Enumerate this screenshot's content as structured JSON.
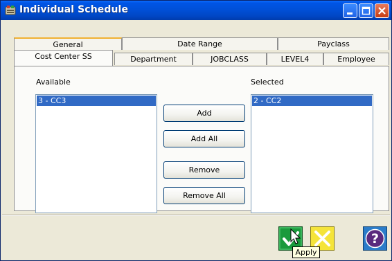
{
  "window": {
    "title": "Individual Schedule"
  },
  "tabs": {
    "row1": [
      "General",
      "Date Range",
      "Payclass"
    ],
    "row2": [
      "Cost Center SS",
      "Department",
      "JOBCLASS",
      "LEVEL4",
      "Employee"
    ],
    "active": "Cost Center SS"
  },
  "available": {
    "label": "Available",
    "items": [
      "3 - CC3"
    ],
    "selected_item": "3 - CC3"
  },
  "selected": {
    "label": "Selected",
    "items": [
      "2 - CC2"
    ],
    "selected_item": "2 - CC2"
  },
  "buttons": {
    "add": "Add",
    "add_all": "Add All",
    "remove": "Remove",
    "remove_all": "Remove All"
  },
  "footer": {
    "apply_icon": "checkmark-icon",
    "cancel_icon": "x-icon",
    "help_icon": "question-icon",
    "tooltip": "Apply"
  },
  "colors": {
    "titlebar": "#0050d8",
    "selection": "#316ac5",
    "apply_green": "#1a9a3c",
    "cancel_yellow": "#f5e43a",
    "help_purple": "#5a2a7e"
  }
}
